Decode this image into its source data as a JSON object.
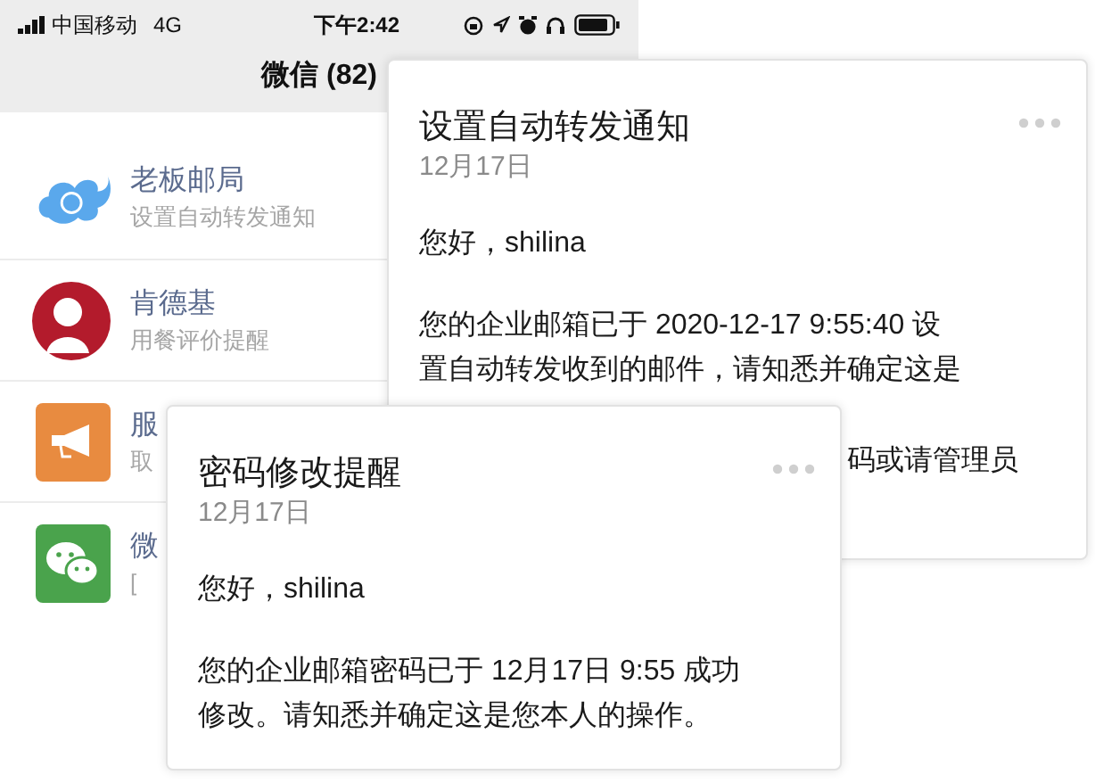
{
  "status_bar": {
    "carrier": "中国移动",
    "network": "4G",
    "time": "下午2:42"
  },
  "header": {
    "title": "微信 (82)"
  },
  "chats": [
    {
      "kind": "mail",
      "name": "老板邮局",
      "preview": "设置自动转发通知"
    },
    {
      "kind": "restaurant",
      "name": "肯德基",
      "preview": "用餐评价提醒"
    },
    {
      "kind": "notice",
      "name": "服",
      "preview": "取"
    },
    {
      "kind": "wechat",
      "name": "微",
      "preview": "["
    }
  ],
  "cards": [
    {
      "title": "设置自动转发通知",
      "date": "12月17日",
      "greeting": "您好，shilina",
      "lines": [
        "您的企业邮箱已于 2020-12-17 9:55:40 设",
        "置自动转发收到的邮件，请知悉并确定这是"
      ],
      "fragment": "码或请管理员"
    },
    {
      "title": "密码修改提醒",
      "date": "12月17日",
      "greeting": "您好，shilina",
      "lines": [
        "您的企业邮箱密码已于 12月17日 9:55 成功",
        "修改。请知悉并确定这是您本人的操作。"
      ]
    }
  ]
}
